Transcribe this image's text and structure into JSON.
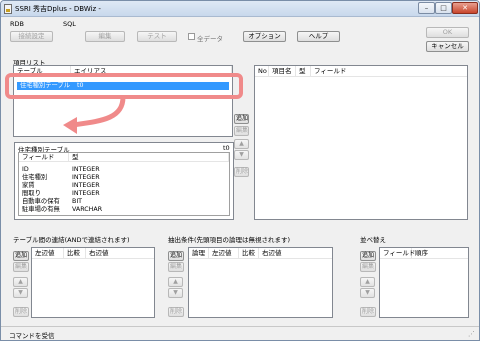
{
  "window": {
    "title": "SSRI 秀吉Dplus - DBWiz -"
  },
  "title_controls": {
    "minimize": "–",
    "maximize": "□",
    "close": "✕"
  },
  "toolbar": {
    "rdb_label": "RDB",
    "connection_settings": "接続設定",
    "sql_label": "SQL",
    "edit": "編集",
    "test": "テスト",
    "all_data": "全データ",
    "options": "オプション",
    "help": "ヘルプ",
    "ok": "OK",
    "cancel": "キャンセル"
  },
  "item_list": {
    "label": "項目リスト",
    "headers": [
      "テーブル",
      "エイリアス"
    ],
    "rows": [
      {
        "table": "住宅種別テーブル",
        "alias": "t0"
      }
    ]
  },
  "side_buttons": {
    "add": "追加",
    "edit": "編集",
    "up": "▲",
    "down": "▼",
    "delete": "削除"
  },
  "fields_table": {
    "title": "住宅種別テーブル",
    "alias": "t0",
    "headers": [
      "フィールド",
      "型"
    ],
    "rows": [
      {
        "field": "ID",
        "type": "INTEGER"
      },
      {
        "field": "住宅種別",
        "type": "INTEGER"
      },
      {
        "field": "家賃",
        "type": "INTEGER"
      },
      {
        "field": "間取り",
        "type": "INTEGER"
      },
      {
        "field": "自動車の保有",
        "type": "BIT"
      },
      {
        "field": "駐車場の有無",
        "type": "VARCHAR"
      }
    ]
  },
  "right_panel": {
    "headers": [
      "No",
      "項目名",
      "型",
      "フィールド"
    ]
  },
  "join": {
    "label": "テーブル間の連結(ANDで連結されます)",
    "headers": [
      "左辺値",
      "比較",
      "右辺値"
    ]
  },
  "conditions": {
    "label": "抽出条件(先頭項目の論理は無視されます)",
    "headers": [
      "論理",
      "左辺値",
      "比較",
      "右辺値"
    ]
  },
  "sort": {
    "label": "並べ替え",
    "headers": [
      "フィールド",
      "順序"
    ]
  },
  "status": {
    "text": "コマンドを受信"
  },
  "colors": {
    "selection": "#3399ff",
    "annotation": "#f08a8a",
    "titlebar": "#dfe9f5"
  }
}
